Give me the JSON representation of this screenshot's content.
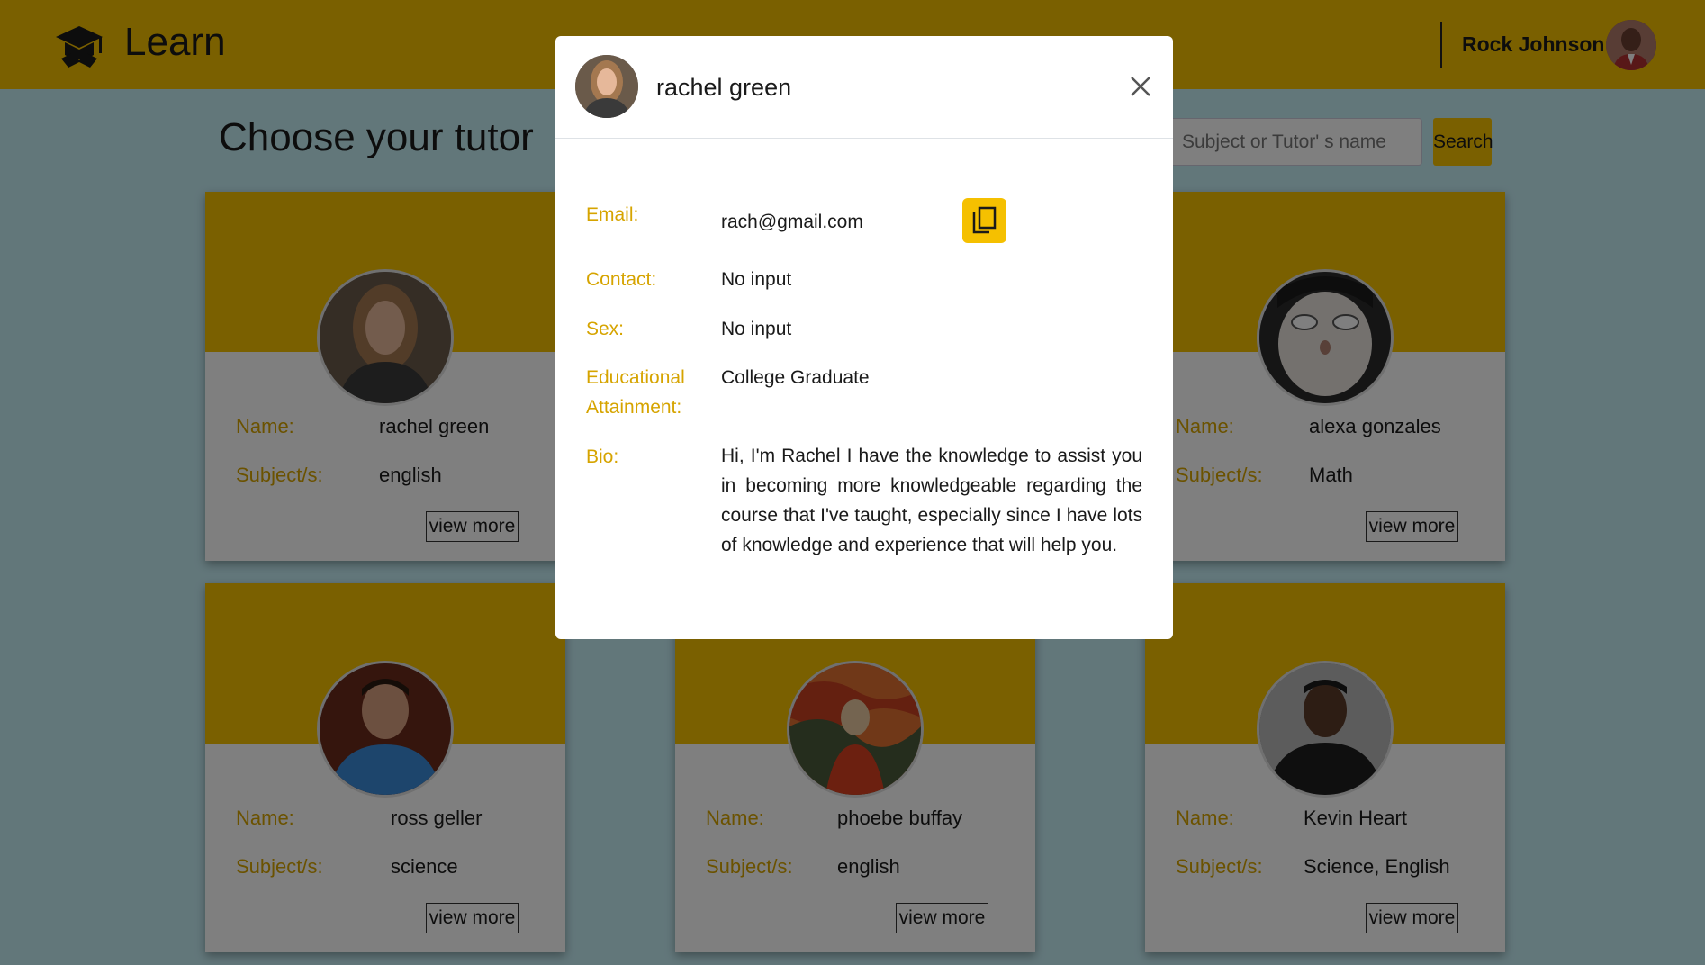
{
  "navbar": {
    "brand": "Learn",
    "user_name": "Rock Johnson"
  },
  "page": {
    "title": "Choose your tutor",
    "search_placeholder": "Subject or Tutor' s name",
    "search_label": "Search"
  },
  "labels": {
    "name": "Name:",
    "subjects": "Subject/s:",
    "view_more": "view more"
  },
  "tutors": [
    {
      "name": "rachel green",
      "subjects": "english",
      "avatar_color": "#8a6a4e"
    },
    {
      "name": "alexa gonzales",
      "subjects": "Math",
      "avatar_color": "#d8d2cc"
    },
    {
      "name": "ross geller",
      "subjects": "science",
      "avatar_color": "#3a6fb3"
    },
    {
      "name": "phoebe buffay",
      "subjects": "english",
      "avatar_color": "#c8522a"
    },
    {
      "name": "Kevin Heart",
      "subjects": "Science, English",
      "avatar_color": "#2a2a2a"
    }
  ],
  "modal": {
    "name": "rachel green",
    "email_label": "Email:",
    "email": "rach@gmail.com",
    "contact_label": "Contact:",
    "contact": "No input",
    "sex_label": "Sex:",
    "sex": "No input",
    "education_label_1": "Educational",
    "education_label_2": "Attainment:",
    "education": "College Graduate",
    "bio_label": "Bio:",
    "bio": "Hi, I'm Rachel I have the knowledge to assist you in becoming more knowledgeable regarding the course that I've taught, especially since I have lots of knowledge and experience that will help you."
  },
  "colors": {
    "accent": "#f5c000",
    "label": "#d6a400",
    "background": "#c5eef5"
  },
  "icons": {
    "logo": "graduation-cap-icon",
    "close": "close-icon",
    "copy": "copy-icon"
  }
}
